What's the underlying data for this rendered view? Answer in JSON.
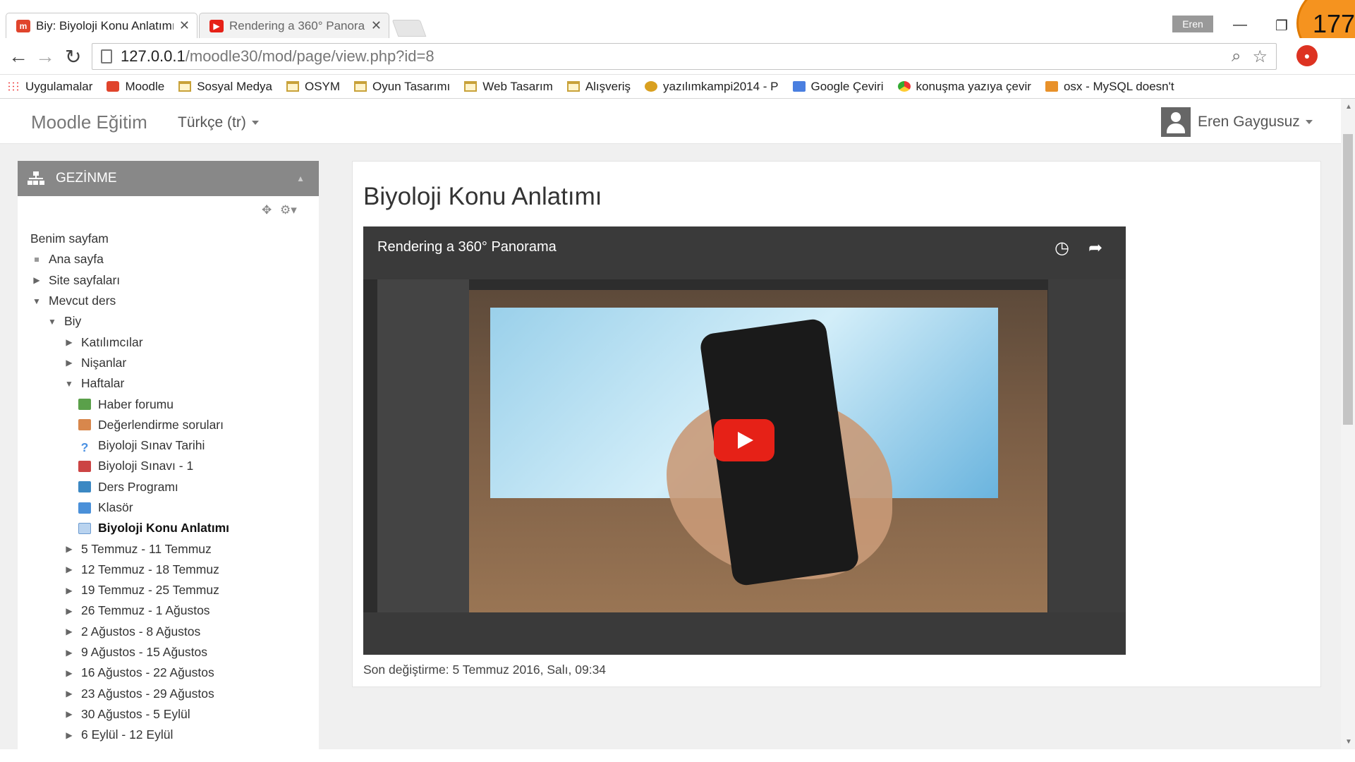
{
  "browser": {
    "tabs": [
      {
        "title": "Biy: Biyoloji Konu Anlatımı",
        "favicon": "moodle-icon",
        "active": true
      },
      {
        "title": "Rendering a 360° Panoram",
        "favicon": "youtube-icon",
        "active": false
      }
    ],
    "profile": "Eren",
    "counter": "177",
    "url_host": "127.0.0.1",
    "url_path": "/moodle30/mod/page/view.php?id=8",
    "bookmarks": [
      {
        "label": "Uygulamalar",
        "icon": "apps-icon"
      },
      {
        "label": "Moodle",
        "icon": "moodle-icon"
      },
      {
        "label": "Sosyal Medya",
        "icon": "folder-icon"
      },
      {
        "label": "OSYM",
        "icon": "folder-icon"
      },
      {
        "label": "Oyun Tasarımı",
        "icon": "folder-icon"
      },
      {
        "label": "Web Tasarım",
        "icon": "folder-icon"
      },
      {
        "label": "Alışveriş",
        "icon": "folder-icon"
      },
      {
        "label": "yazılımkampi2014 - P",
        "icon": "page-icon"
      },
      {
        "label": "Google Çeviri",
        "icon": "translate-icon"
      },
      {
        "label": "konuşma yazıya çevir",
        "icon": "chrome-icon"
      },
      {
        "label": "osx - MySQL doesn't",
        "icon": "java-icon"
      }
    ]
  },
  "moodle": {
    "brand": "Moodle Eğitim",
    "language": "Türkçe (tr)",
    "user": "Eren Gaygusuz",
    "nav_block_title": "GEZİNME",
    "nav": {
      "my_page": "Benim sayfam",
      "home": "Ana sayfa",
      "site_pages": "Site sayfaları",
      "current_course": "Mevcut ders",
      "course": "Biy",
      "participants": "Katılımcılar",
      "badges": "Nişanlar",
      "weeks": "Haftalar",
      "activities": [
        {
          "label": "Haber forumu",
          "icon": "forum-icon"
        },
        {
          "label": "Değerlendirme soruları",
          "icon": "feedback-icon"
        },
        {
          "label": "Biyoloji Sınav Tarihi",
          "icon": "question-icon"
        },
        {
          "label": "Biyoloji Sınavı - 1",
          "icon": "quiz-icon"
        },
        {
          "label": "Ders Programı",
          "icon": "url-icon"
        },
        {
          "label": "Klasör",
          "icon": "folder-icon"
        },
        {
          "label": "Biyoloji Konu Anlatımı",
          "icon": "page-icon"
        }
      ],
      "week_list": [
        "5 Temmuz - 11 Temmuz",
        "12 Temmuz - 18 Temmuz",
        "19 Temmuz - 25 Temmuz",
        "26 Temmuz - 1 Ağustos",
        "2 Ağustos - 8 Ağustos",
        "9 Ağustos - 15 Ağustos",
        "16 Ağustos - 22 Ağustos",
        "23 Ağustos - 29 Ağustos",
        "30 Ağustos - 5 Eylül",
        "6 Eylül - 12 Eylül"
      ]
    },
    "page_title": "Biyoloji Konu Anlatımı",
    "video_title": "Rendering a 360° Panorama",
    "last_modified": "Son değiştirme: 5 Temmuz 2016, Salı, 09:34"
  }
}
